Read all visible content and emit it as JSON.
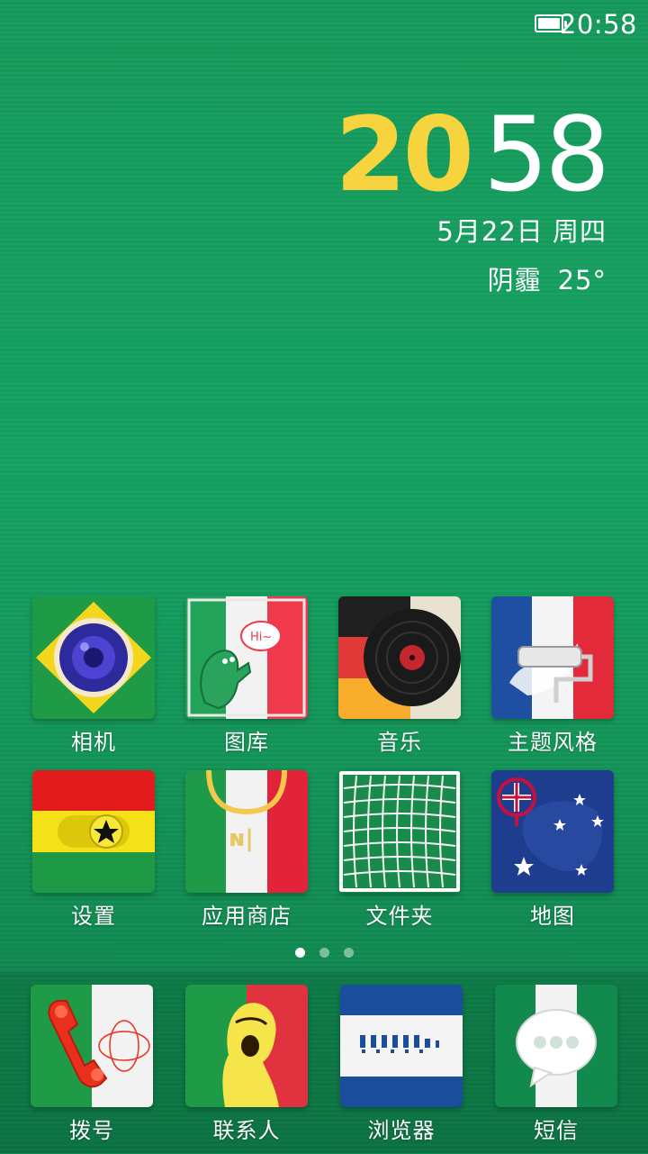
{
  "status_bar": {
    "time": "20:58",
    "battery_icon": "battery-full-icon"
  },
  "clock": {
    "hour": "20",
    "minute": "58",
    "date": "5月22日 周四",
    "weather": "阴霾",
    "temperature": "25°"
  },
  "colors": {
    "accent_hour": "#f7d43d",
    "background": "#15a262"
  },
  "apps": [
    {
      "label": "相机",
      "icon": "camera-icon"
    },
    {
      "label": "图库",
      "icon": "gallery-icon"
    },
    {
      "label": "音乐",
      "icon": "music-icon"
    },
    {
      "label": "主题风格",
      "icon": "theme-icon"
    },
    {
      "label": "设置",
      "icon": "settings-icon"
    },
    {
      "label": "应用商店",
      "icon": "app-store-icon"
    },
    {
      "label": "文件夹",
      "icon": "folder-icon"
    },
    {
      "label": "地图",
      "icon": "map-icon"
    }
  ],
  "page_indicator": {
    "pages": 3,
    "current": 1
  },
  "dock": [
    {
      "label": "拨号",
      "icon": "phone-icon"
    },
    {
      "label": "联系人",
      "icon": "contacts-icon"
    },
    {
      "label": "浏览器",
      "icon": "browser-icon"
    },
    {
      "label": "短信",
      "icon": "messages-icon"
    }
  ]
}
